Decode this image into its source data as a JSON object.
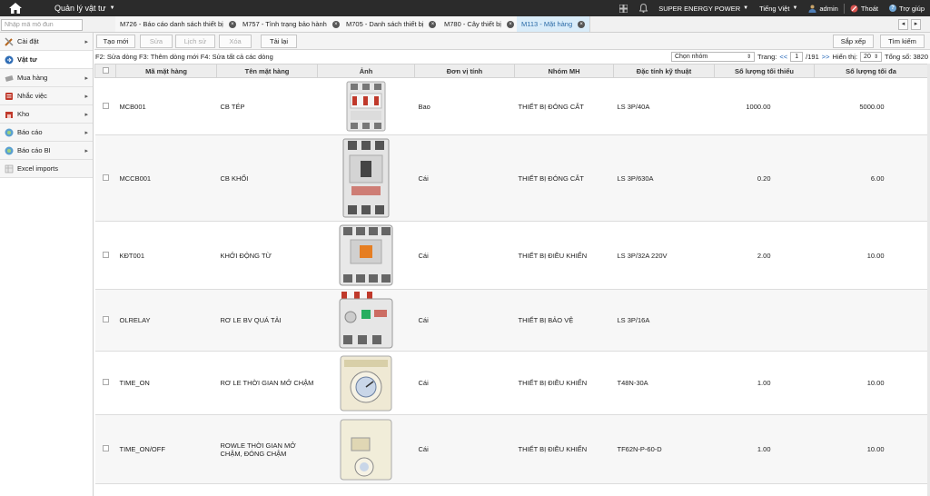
{
  "app": {
    "title": "Quản lý vật tư"
  },
  "topbar": {
    "company": "SUPER ENERGY POWER",
    "language": "Tiếng Việt",
    "user": "admin",
    "logout": "Thoát",
    "help": "Trợ giúp"
  },
  "search": {
    "placeholder": "Nhập mã mô đun"
  },
  "tabs": [
    {
      "label": "M726 - Báo cáo danh sách thiết bị",
      "active": false
    },
    {
      "label": "M757 - Tình trạng bảo hành",
      "active": false
    },
    {
      "label": "M705 - Danh sách thiết bị",
      "active": false
    },
    {
      "label": "M780 - Cây thiết bị",
      "active": false
    },
    {
      "label": "M113 - Mặt hàng",
      "active": true
    }
  ],
  "tab_nav": {
    "prev": "◂",
    "next": "▸"
  },
  "sidebar": {
    "items": [
      {
        "label": "Cài đặt",
        "icon": "tools-icon",
        "chevron": "▸"
      },
      {
        "label": "Vật tư",
        "icon": "material-icon",
        "chevron": ""
      },
      {
        "label": "Mua hàng",
        "icon": "purchase-icon",
        "chevron": "▸"
      },
      {
        "label": "Nhắc việc",
        "icon": "reminder-icon",
        "chevron": "▸"
      },
      {
        "label": "Kho",
        "icon": "warehouse-icon",
        "chevron": "▸"
      },
      {
        "label": "Báo cáo",
        "icon": "report-icon",
        "chevron": "▸"
      },
      {
        "label": "Báo cáo BI",
        "icon": "bi-report-icon",
        "chevron": "▸"
      },
      {
        "label": "Excel imports",
        "icon": "excel-icon",
        "chevron": ""
      }
    ]
  },
  "toolbar": {
    "create": "Tạo mới",
    "edit": "Sửa",
    "history": "Lịch sử",
    "delete": "Xóa",
    "reload": "Tải lại",
    "sort": "Sắp xếp",
    "search": "Tìm kiếm"
  },
  "hint": "F2: Sửa dòng F3: Thêm dòng mới F4: Sửa tất cả các dòng",
  "pager": {
    "group_select": "Chọn nhóm",
    "page_label": "Trang:",
    "prev": "<<",
    "page": "1",
    "total_pages": "/191",
    "next": ">>",
    "show_label": "Hiển thị:",
    "page_size": "20",
    "total": "Tổng số: 3820"
  },
  "columns": {
    "code": "Mã mặt hàng",
    "name": "Tên mặt hàng",
    "image": "Ảnh",
    "unit": "Đơn vị tính",
    "group": "Nhóm MH",
    "spec": "Đặc tính kỹ thuật",
    "min": "Số lượng tối thiểu",
    "max": "Số lượng tối đa"
  },
  "rows": [
    {
      "code": "MCB001",
      "name": "CB TÉP",
      "unit": "Bao",
      "group": "THIẾT BỊ ĐÓNG CẮT",
      "spec": "LS 3P/40A",
      "min": "1000.00",
      "max": "5000.00"
    },
    {
      "code": "MCCB001",
      "name": "CB KHỐI",
      "unit": "Cái",
      "group": "THIẾT BỊ ĐÓNG CẮT",
      "spec": "LS 3P/630A",
      "min": "0.20",
      "max": "6.00"
    },
    {
      "code": "KĐT001",
      "name": "KHỞI ĐỘNG TỪ",
      "unit": "Cái",
      "group": "THIẾT BỊ ĐIỀU KHIỂN",
      "spec": "LS 3P/32A 220V",
      "min": "2.00",
      "max": "10.00"
    },
    {
      "code": "OLRELAY",
      "name": "RƠ LE BV QUÁ TẢI",
      "unit": "Cái",
      "group": "THIẾT BỊ BẢO VỆ",
      "spec": "LS 3P/16A",
      "min": "",
      "max": ""
    },
    {
      "code": "TIME_ON",
      "name": "RƠ LE THỜI GIAN MỞ CHẬM",
      "unit": "Cái",
      "group": "THIẾT BỊ ĐIỀU KHIỂN",
      "spec": "T48N-30A",
      "min": "1.00",
      "max": "10.00"
    },
    {
      "code": "TIME_ON/OFF",
      "name": "ROWLE THỜI GIAN MỞ CHẬM, ĐÓNG CHẬM",
      "unit": "Cái",
      "group": "THIẾT BỊ ĐIỀU KHIỂN",
      "spec": "TF62N-P-60-D",
      "min": "1.00",
      "max": "10.00"
    }
  ],
  "colors": {
    "topbar": "#2b2b2b",
    "active_tab": "#d9ecf9",
    "link": "#1a5fb4"
  }
}
